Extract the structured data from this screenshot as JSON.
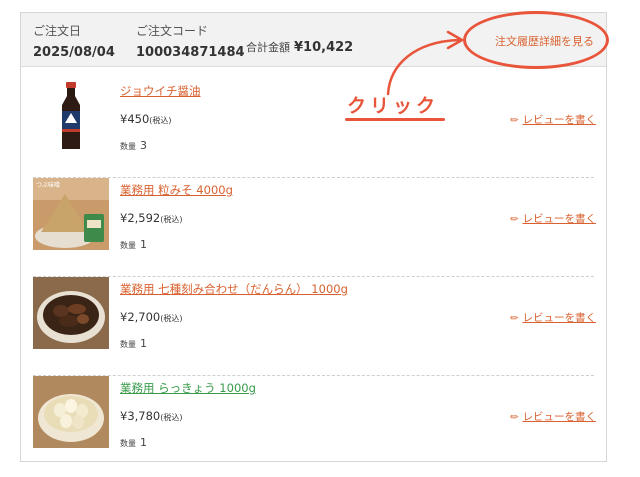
{
  "order": {
    "date_label": "ご注文日",
    "date_value": "2025/08/04",
    "code_label": "ご注文コード",
    "code_value": "100034871484",
    "total_label": "合計金額",
    "total_value": "¥10,422",
    "detail_link": "注文履歴詳細を見る"
  },
  "annotation": {
    "text": "クリック",
    "color": "#e8553b"
  },
  "items": [
    {
      "name": "ジョウイチ醤油",
      "price": "¥450",
      "tax": "(税込)",
      "qty_label": "数量",
      "qty": "3",
      "review": "レビューを書く",
      "name_color": "#d9612f",
      "image": "soy-sauce-bottle"
    },
    {
      "name": "業務用 粒みそ 4000g",
      "price": "¥2,592",
      "tax": "(税込)",
      "qty_label": "数量",
      "qty": "1",
      "review": "レビューを書く",
      "name_color": "#d9612f",
      "image": "miso-bowl",
      "image_text": "つぶ味噌"
    },
    {
      "name": "業務用 七種刻み合わせ（だんらん） 1000g",
      "price": "¥2,700",
      "tax": "(税込)",
      "qty_label": "数量",
      "qty": "1",
      "review": "レビューを書く",
      "name_color": "#d9612f",
      "image": "pickles-bowl"
    },
    {
      "name": "業務用 らっきょう 1000g",
      "price": "¥3,780",
      "tax": "(税込)",
      "qty_label": "数量",
      "qty": "1",
      "review": "レビューを書く",
      "name_color": "#3a9a4a",
      "image": "rakkyo-bowl"
    }
  ],
  "colors": {
    "accent": "#d9612f",
    "header_bg": "#f2f2f2",
    "link_green": "#3a9a4a"
  }
}
